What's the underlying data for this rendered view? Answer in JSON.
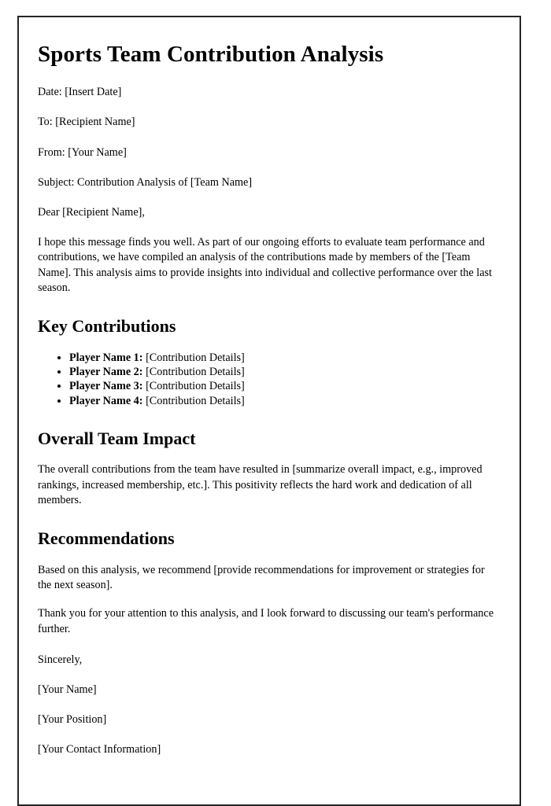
{
  "document": {
    "title": "Sports Team Contribution Analysis",
    "header_lines": [
      "Date: [Insert Date]",
      "To: [Recipient Name]",
      "From: [Your Name]",
      "Subject: Contribution Analysis of [Team Name]"
    ],
    "salutation": "Dear [Recipient Name],",
    "intro_paragraph": "I hope this message finds you well. As part of our ongoing efforts to evaluate team performance and contributions, we have compiled an analysis of the contributions made by members of the [Team Name]. This analysis aims to provide insights into individual and collective performance over the last season.",
    "sections": {
      "key_contributions": {
        "heading": "Key Contributions",
        "items": [
          {
            "label": "Player Name 1:",
            "detail": "[Contribution Details]"
          },
          {
            "label": "Player Name 2:",
            "detail": "[Contribution Details]"
          },
          {
            "label": "Player Name 3:",
            "detail": "[Contribution Details]"
          },
          {
            "label": "Player Name 4:",
            "detail": "[Contribution Details]"
          }
        ]
      },
      "overall_team_impact": {
        "heading": "Overall Team Impact",
        "paragraph": "The overall contributions from the team have resulted in [summarize overall impact, e.g., improved rankings, increased membership, etc.]. This positivity reflects the hard work and dedication of all members."
      },
      "recommendations": {
        "heading": "Recommendations",
        "paragraph_1": "Based on this analysis, we recommend [provide recommendations for improvement or strategies for the next season].",
        "paragraph_2": "Thank you for your attention to this analysis, and I look forward to discussing our team's performance further."
      }
    },
    "closing": {
      "valediction": "Sincerely,",
      "name": "[Your Name]",
      "position": "[Your Position]",
      "contact": "[Your Contact Information]"
    }
  }
}
